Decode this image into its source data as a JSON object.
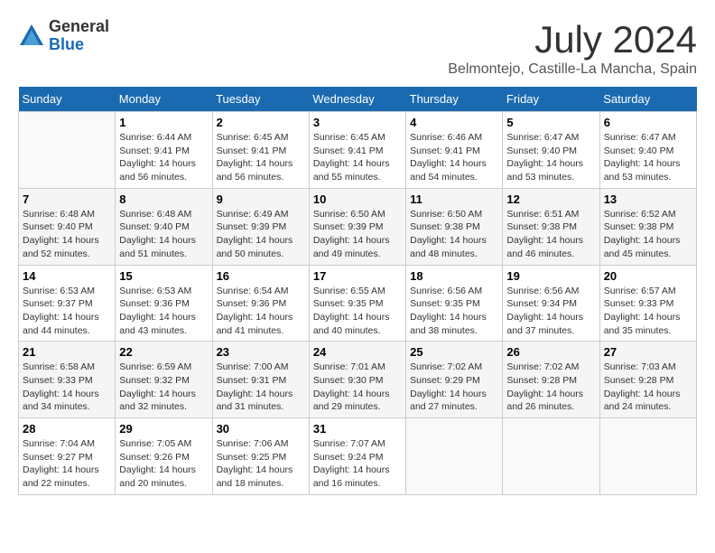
{
  "header": {
    "logo_general": "General",
    "logo_blue": "Blue",
    "month": "July 2024",
    "location": "Belmontejo, Castille-La Mancha, Spain"
  },
  "weekdays": [
    "Sunday",
    "Monday",
    "Tuesday",
    "Wednesday",
    "Thursday",
    "Friday",
    "Saturday"
  ],
  "weeks": [
    [
      {
        "day": "",
        "info": ""
      },
      {
        "day": "1",
        "info": "Sunrise: 6:44 AM\nSunset: 9:41 PM\nDaylight: 14 hours\nand 56 minutes."
      },
      {
        "day": "2",
        "info": "Sunrise: 6:45 AM\nSunset: 9:41 PM\nDaylight: 14 hours\nand 56 minutes."
      },
      {
        "day": "3",
        "info": "Sunrise: 6:45 AM\nSunset: 9:41 PM\nDaylight: 14 hours\nand 55 minutes."
      },
      {
        "day": "4",
        "info": "Sunrise: 6:46 AM\nSunset: 9:41 PM\nDaylight: 14 hours\nand 54 minutes."
      },
      {
        "day": "5",
        "info": "Sunrise: 6:47 AM\nSunset: 9:40 PM\nDaylight: 14 hours\nand 53 minutes."
      },
      {
        "day": "6",
        "info": "Sunrise: 6:47 AM\nSunset: 9:40 PM\nDaylight: 14 hours\nand 53 minutes."
      }
    ],
    [
      {
        "day": "7",
        "info": "Sunrise: 6:48 AM\nSunset: 9:40 PM\nDaylight: 14 hours\nand 52 minutes."
      },
      {
        "day": "8",
        "info": "Sunrise: 6:48 AM\nSunset: 9:40 PM\nDaylight: 14 hours\nand 51 minutes."
      },
      {
        "day": "9",
        "info": "Sunrise: 6:49 AM\nSunset: 9:39 PM\nDaylight: 14 hours\nand 50 minutes."
      },
      {
        "day": "10",
        "info": "Sunrise: 6:50 AM\nSunset: 9:39 PM\nDaylight: 14 hours\nand 49 minutes."
      },
      {
        "day": "11",
        "info": "Sunrise: 6:50 AM\nSunset: 9:38 PM\nDaylight: 14 hours\nand 48 minutes."
      },
      {
        "day": "12",
        "info": "Sunrise: 6:51 AM\nSunset: 9:38 PM\nDaylight: 14 hours\nand 46 minutes."
      },
      {
        "day": "13",
        "info": "Sunrise: 6:52 AM\nSunset: 9:38 PM\nDaylight: 14 hours\nand 45 minutes."
      }
    ],
    [
      {
        "day": "14",
        "info": "Sunrise: 6:53 AM\nSunset: 9:37 PM\nDaylight: 14 hours\nand 44 minutes."
      },
      {
        "day": "15",
        "info": "Sunrise: 6:53 AM\nSunset: 9:36 PM\nDaylight: 14 hours\nand 43 minutes."
      },
      {
        "day": "16",
        "info": "Sunrise: 6:54 AM\nSunset: 9:36 PM\nDaylight: 14 hours\nand 41 minutes."
      },
      {
        "day": "17",
        "info": "Sunrise: 6:55 AM\nSunset: 9:35 PM\nDaylight: 14 hours\nand 40 minutes."
      },
      {
        "day": "18",
        "info": "Sunrise: 6:56 AM\nSunset: 9:35 PM\nDaylight: 14 hours\nand 38 minutes."
      },
      {
        "day": "19",
        "info": "Sunrise: 6:56 AM\nSunset: 9:34 PM\nDaylight: 14 hours\nand 37 minutes."
      },
      {
        "day": "20",
        "info": "Sunrise: 6:57 AM\nSunset: 9:33 PM\nDaylight: 14 hours\nand 35 minutes."
      }
    ],
    [
      {
        "day": "21",
        "info": "Sunrise: 6:58 AM\nSunset: 9:33 PM\nDaylight: 14 hours\nand 34 minutes."
      },
      {
        "day": "22",
        "info": "Sunrise: 6:59 AM\nSunset: 9:32 PM\nDaylight: 14 hours\nand 32 minutes."
      },
      {
        "day": "23",
        "info": "Sunrise: 7:00 AM\nSunset: 9:31 PM\nDaylight: 14 hours\nand 31 minutes."
      },
      {
        "day": "24",
        "info": "Sunrise: 7:01 AM\nSunset: 9:30 PM\nDaylight: 14 hours\nand 29 minutes."
      },
      {
        "day": "25",
        "info": "Sunrise: 7:02 AM\nSunset: 9:29 PM\nDaylight: 14 hours\nand 27 minutes."
      },
      {
        "day": "26",
        "info": "Sunrise: 7:02 AM\nSunset: 9:28 PM\nDaylight: 14 hours\nand 26 minutes."
      },
      {
        "day": "27",
        "info": "Sunrise: 7:03 AM\nSunset: 9:28 PM\nDaylight: 14 hours\nand 24 minutes."
      }
    ],
    [
      {
        "day": "28",
        "info": "Sunrise: 7:04 AM\nSunset: 9:27 PM\nDaylight: 14 hours\nand 22 minutes."
      },
      {
        "day": "29",
        "info": "Sunrise: 7:05 AM\nSunset: 9:26 PM\nDaylight: 14 hours\nand 20 minutes."
      },
      {
        "day": "30",
        "info": "Sunrise: 7:06 AM\nSunset: 9:25 PM\nDaylight: 14 hours\nand 18 minutes."
      },
      {
        "day": "31",
        "info": "Sunrise: 7:07 AM\nSunset: 9:24 PM\nDaylight: 14 hours\nand 16 minutes."
      },
      {
        "day": "",
        "info": ""
      },
      {
        "day": "",
        "info": ""
      },
      {
        "day": "",
        "info": ""
      }
    ]
  ]
}
